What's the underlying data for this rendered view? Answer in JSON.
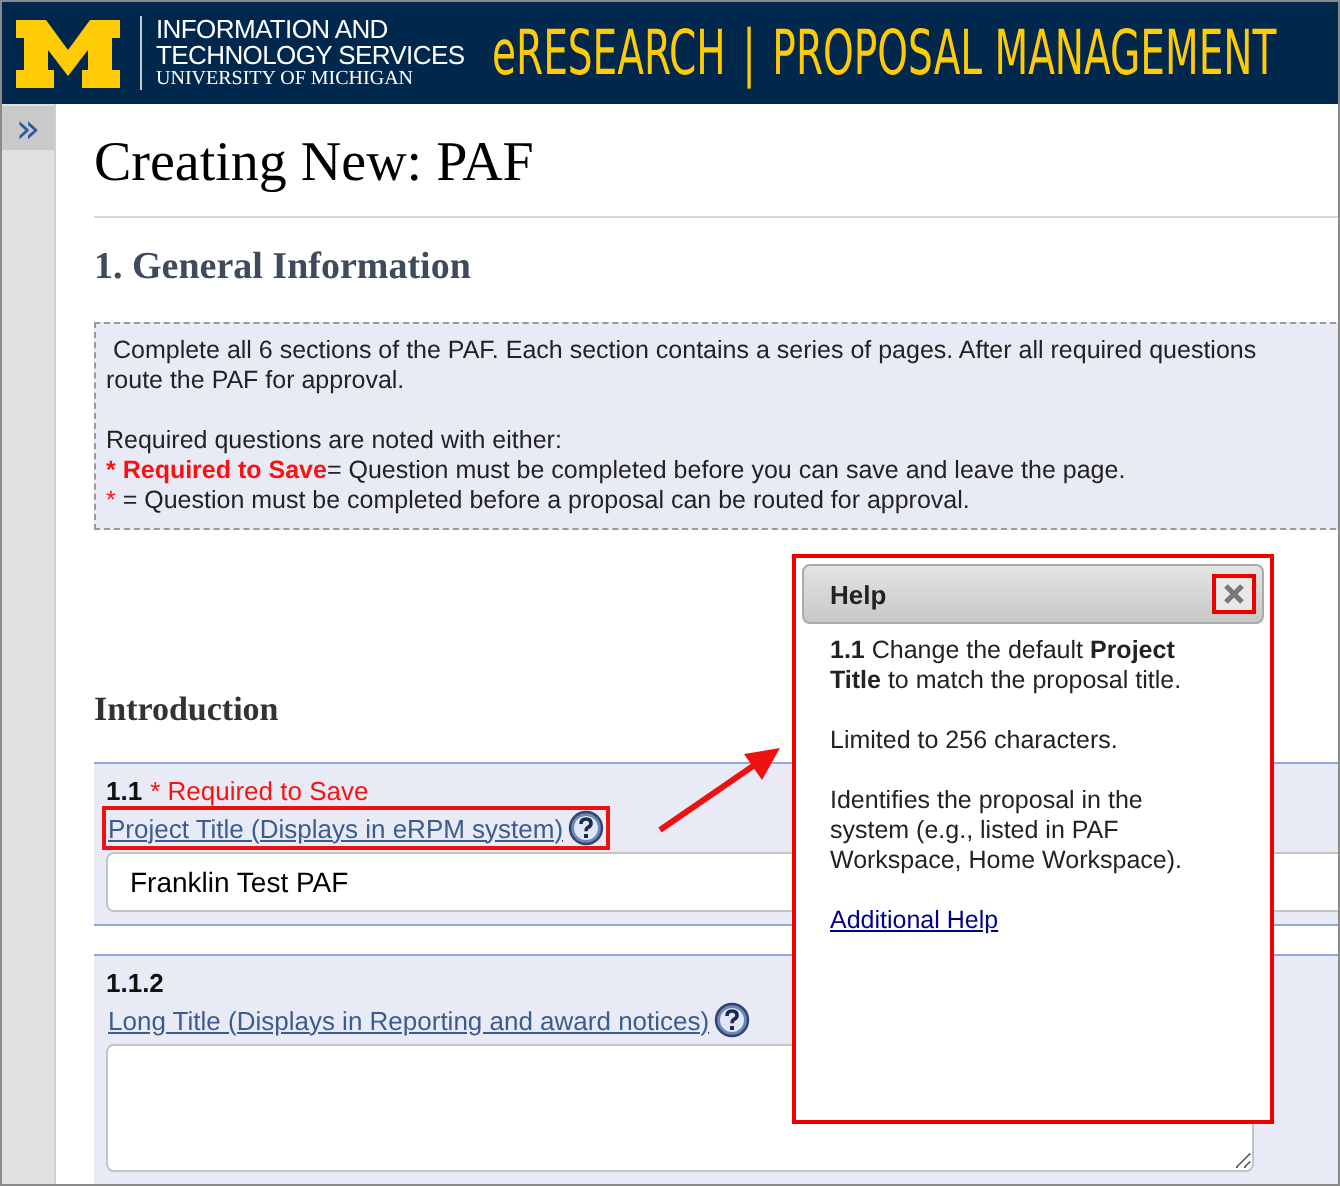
{
  "header": {
    "org_lines": [
      "INFORMATION AND",
      "TECHNOLOGY SERVICES"
    ],
    "org_sub": "UNIVERSITY OF MICHIGAN",
    "app_name": "eRESEARCH",
    "separator": "|",
    "app_module": "PROPOSAL MANAGEMENT"
  },
  "sidebar": {
    "toggle": "»"
  },
  "page": {
    "title": "Creating New: PAF",
    "section": "1. General Information",
    "info": {
      "lines": [
        "Complete all 6 sections of the PAF. Each section contains a series of pages. After all required questions",
        "route the PAF for approval."
      ],
      "legend_intro": "Required questions are noted with either:",
      "legend": [
        {
          "kind": "save",
          "mark": "* Required to Save",
          "text": "= Question must be completed before you can save and leave the page."
        },
        {
          "kind": "route",
          "mark": "*",
          "text": " = Question must be completed before a proposal can be routed for approval."
        }
      ]
    },
    "subsection": "Introduction",
    "questions": [
      {
        "number": "1.1",
        "required": "* Required to Save",
        "label": "Project Title (Displays in eRPM system)",
        "kind": "text",
        "value": "Franklin Test PAF",
        "highlighted": true
      },
      {
        "number": "1.1.2",
        "label": "Long Title (Displays in Reporting and award notices)",
        "kind": "textarea",
        "highlighted": false
      }
    ]
  },
  "help": {
    "title": "Help",
    "paragraphs": [
      "**1.1** Change the default **Project Title** to match the proposal title.",
      "Limited to 256 characters.",
      "Identifies the proposal in the system (e.g., listed in PAF Workspace, Home Workspace)."
    ],
    "link": "Additional Help"
  }
}
